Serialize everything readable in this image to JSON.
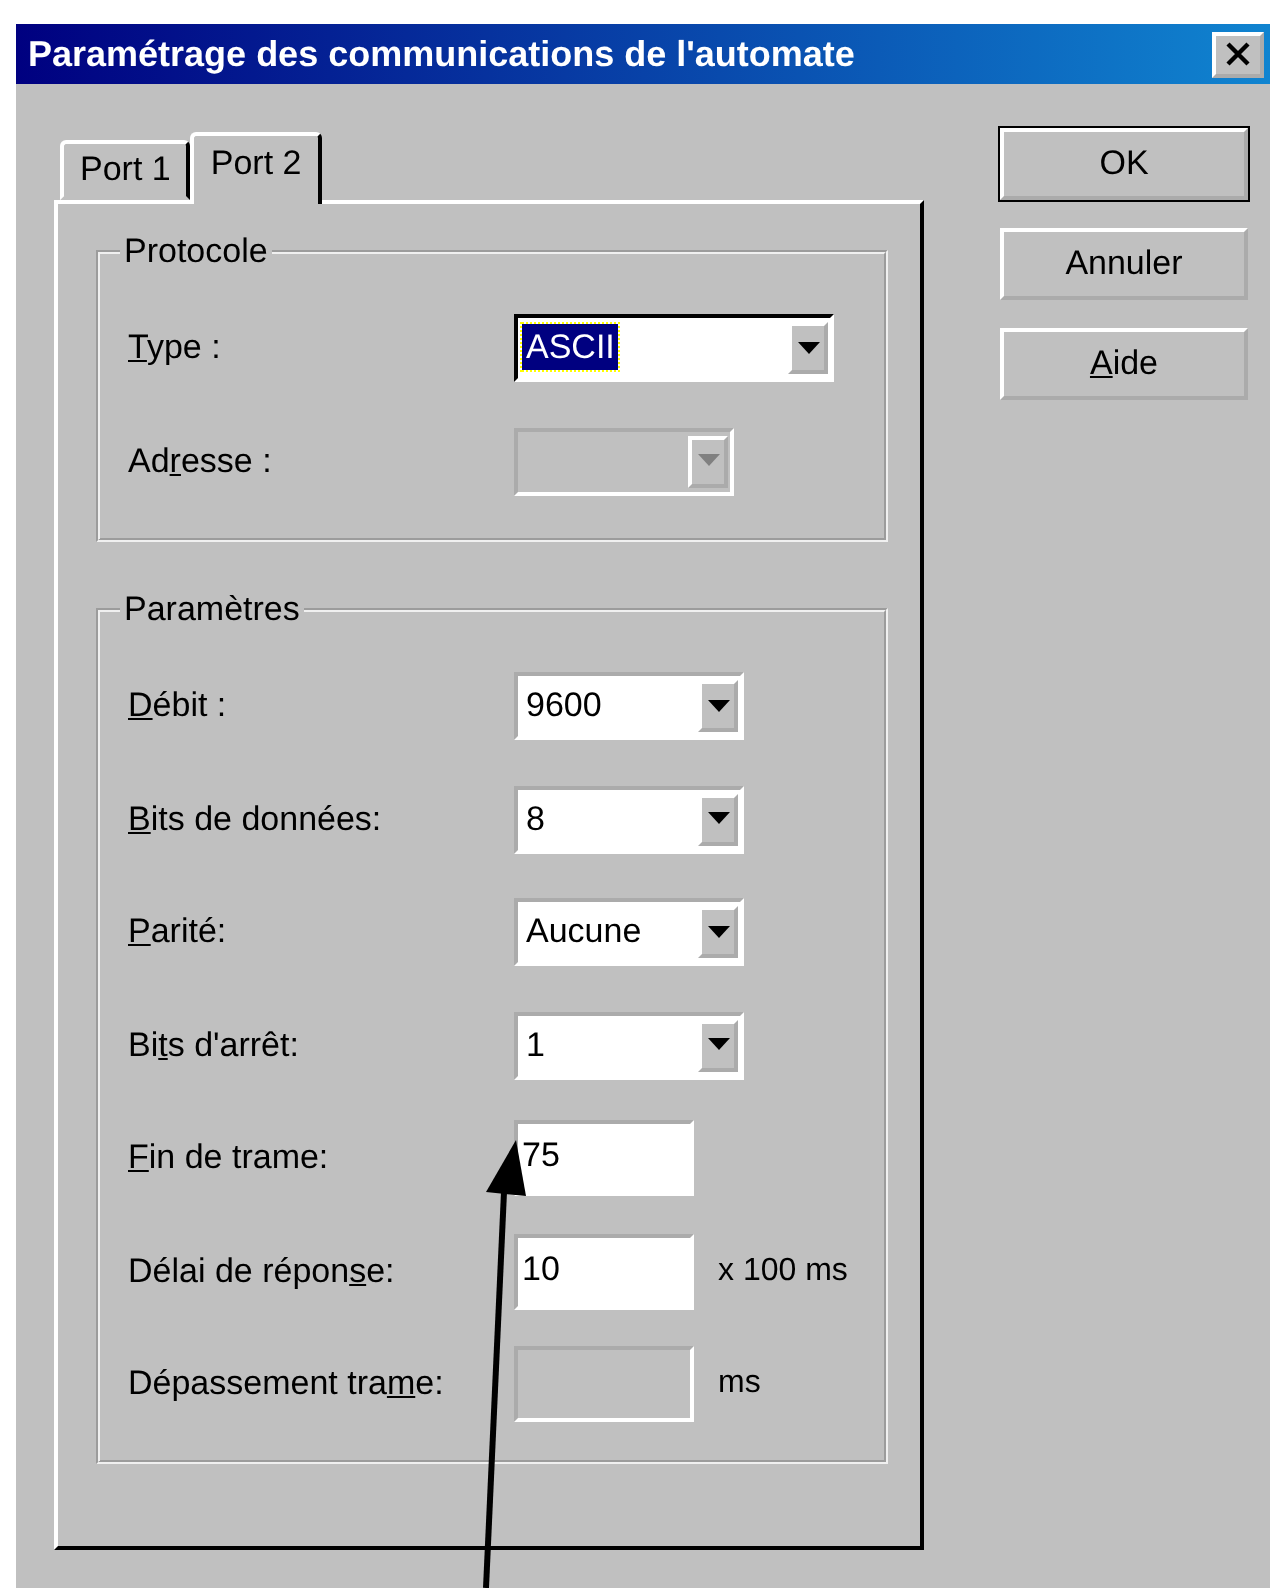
{
  "window": {
    "title": "Paramétrage des communications de l'automate"
  },
  "tabs": [
    {
      "label": "Port 1",
      "selected": false
    },
    {
      "label": "Port 2",
      "selected": true
    }
  ],
  "groups": [
    {
      "title": "Protocole",
      "fields": [
        {
          "kind": "combo",
          "label": {
            "key": "T",
            "after": "ype :"
          },
          "value": "ASCII",
          "disabled": false,
          "focused": true
        },
        {
          "kind": "combo",
          "label": {
            "before": "Ad",
            "key": "r",
            "after": "esse :"
          },
          "disabled": true,
          "focused": false
        }
      ]
    },
    {
      "title": "Paramètres",
      "fields": [
        {
          "kind": "combo",
          "label": {
            "key": "D",
            "after": "ébit :"
          },
          "value": "9600",
          "disabled": false,
          "focused": false
        },
        {
          "kind": "combo",
          "label": {
            "key": "B",
            "after": "its de données:"
          },
          "value": "8",
          "disabled": false,
          "focused": false
        },
        {
          "kind": "combo",
          "label": {
            "key": "P",
            "after": "arité:"
          },
          "value": "Aucune",
          "disabled": false,
          "focused": false
        },
        {
          "kind": "combo",
          "label": {
            "before": "Bi",
            "key": "t",
            "after": "s d'arrêt:"
          },
          "value": "1",
          "disabled": false,
          "focused": false
        },
        {
          "kind": "text",
          "label": {
            "key": "F",
            "after": "in de trame:"
          },
          "value": "75",
          "disabled": false
        },
        {
          "kind": "text",
          "label": {
            "before": "Délai de répon",
            "key": "s",
            "after": "e:"
          },
          "value": "10",
          "unit": "x 100 ms",
          "disabled": false
        },
        {
          "kind": "text",
          "label": {
            "before": "Dépassement tra",
            "key": "m",
            "after": "e:"
          },
          "unit": "ms",
          "disabled": true
        }
      ]
    }
  ],
  "buttons": [
    {
      "label": {
        "before": "OK"
      },
      "default": true
    },
    {
      "label": {
        "before": "Annuler"
      },
      "default": false
    },
    {
      "label": {
        "key": "A",
        "after": "ide"
      },
      "default": false
    }
  ]
}
